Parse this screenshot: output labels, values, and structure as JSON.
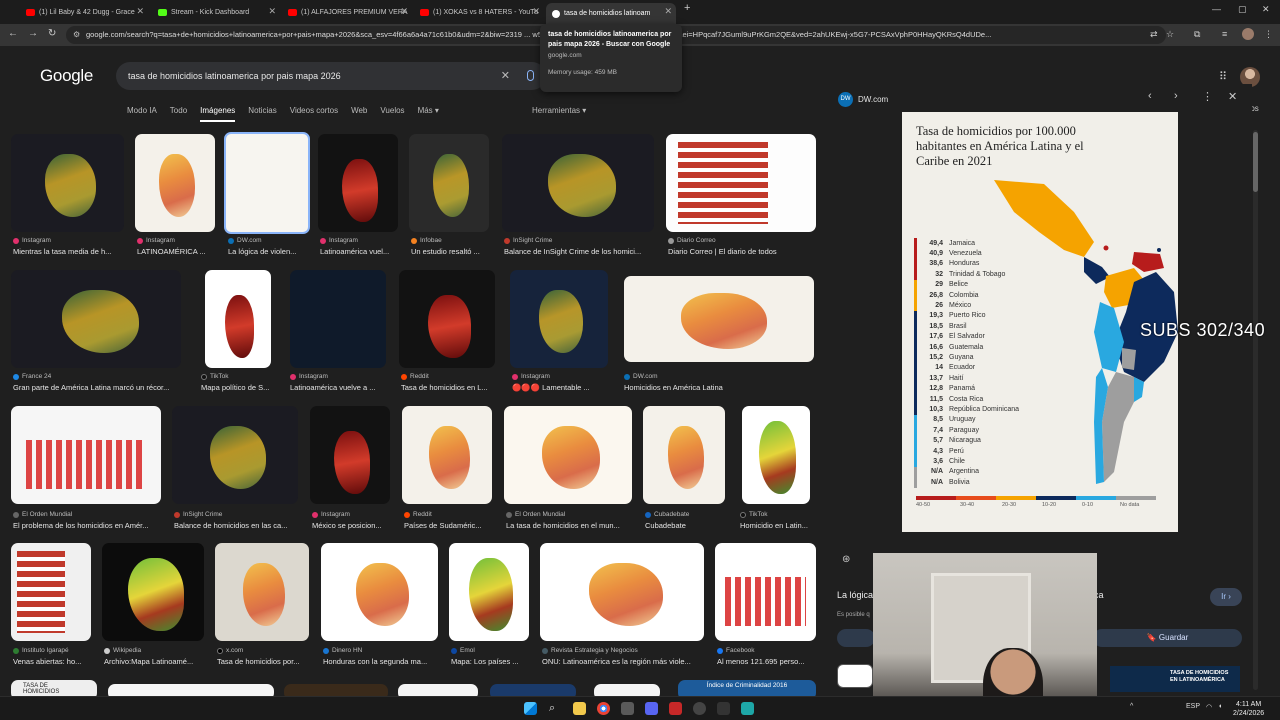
{
  "browser": {
    "tabs": [
      {
        "title": "(1) Lil Baby & 42 Dugg - Grace",
        "color": "#ff0000"
      },
      {
        "title": "Stream - Kick Dashboard",
        "color": "#53fc18"
      },
      {
        "title": "(1) ALFAJORES PREMIUM VERA",
        "color": "#ff0000"
      },
      {
        "title": "(1) XOKAS vs 8 HATERS - YouTu",
        "color": "#ff0000"
      },
      {
        "title": "tasa de homicidios latinoam",
        "color": "#ffffff"
      }
    ],
    "new_tab": "+",
    "url": "google.com/search?q=tasa+de+homicidios+latinoamerica+por+pais+mapa+2026&sca_esv=4f66a6a4a71c61b0&udm=2&biw=2319 ... w5EOAxUtV68XZM_A%3A1771895324440&ei=HPqcaf7JGuml9uPrKGm2QE&ved=2ahUKEwj-x5G7-PCSAxVphP0HHayQKRsQ4dUDe...",
    "tooltip": {
      "title": "tasa de homicidios latinoamerica por pais mapa 2026 - Buscar con Google",
      "domain": "google.com",
      "memory": "Memory usage: 459 MB"
    }
  },
  "google": {
    "logo": "Google",
    "query": "tasa de homicidios latinoamerica por pais mapa 2026",
    "tabs": [
      "Modo IA",
      "Todo",
      "Imágenes",
      "Noticias",
      "Videos cortos",
      "Web",
      "Vuelos",
      "Más ▾"
    ],
    "active_tab": "Imágenes",
    "tools": "Herramientas ▾",
    "saved": "Guardados"
  },
  "results": [
    {
      "src": "Instagram",
      "title": "Mientras la tasa media de h...",
      "color": "#e1306c"
    },
    {
      "src": "Instagram",
      "title": "LATINOAMÉRICA ...",
      "color": "#e1306c"
    },
    {
      "src": "DW.com",
      "title": "La lógica de violen...",
      "color": "#0b6fb5"
    },
    {
      "src": "Instagram",
      "title": "Latinoamérica vuel...",
      "color": "#e1306c"
    },
    {
      "src": "Infobae",
      "title": "Un estudio resaltó ...",
      "color": "#f58220"
    },
    {
      "src": "InSight Crime",
      "title": "Balance de InSight Crime de los homici...",
      "color": "#c0392b"
    },
    {
      "src": "Diario Correo",
      "title": "Diario Correo | El diario de todos",
      "color": "#999999"
    },
    {
      "src": "France 24",
      "title": "Gran parte de América Latina marcó un récor...",
      "color": "#1e88e5"
    },
    {
      "src": "TikTok",
      "title": "Mapa político de S...",
      "color": "#111111"
    },
    {
      "src": "Instagram",
      "title": "Latinoamérica vuelve a ...",
      "color": "#e1306c"
    },
    {
      "src": "Reddit",
      "title": "Tasa de homicidios en L...",
      "color": "#ff4500"
    },
    {
      "src": "Instagram",
      "title": "🔴🔴🔴 Lamentable ...",
      "color": "#e1306c"
    },
    {
      "src": "DW.com",
      "title": "Homicidios en América Latina",
      "color": "#0b6fb5"
    },
    {
      "src": "El Orden Mundial",
      "title": "El problema de los homicidios en Amér...",
      "color": "#666666"
    },
    {
      "src": "InSight Crime",
      "title": "Balance de homicidios en las ca...",
      "color": "#c0392b"
    },
    {
      "src": "Instagram",
      "title": "México se posicion...",
      "color": "#e1306c"
    },
    {
      "src": "Reddit",
      "title": "Países de Sudaméric...",
      "color": "#ff4500"
    },
    {
      "src": "El Orden Mundial",
      "title": "La tasa de homicidios en el mun...",
      "color": "#666666"
    },
    {
      "src": "Cubadebate",
      "title": "Cubadebate",
      "color": "#1565c0"
    },
    {
      "src": "TikTok",
      "title": "Homicidio en Latin...",
      "color": "#111111"
    },
    {
      "src": "Instituto Igarapé",
      "title": "Venas abiertas: ho...",
      "color": "#2e7d32"
    },
    {
      "src": "Wikipedia",
      "title": "Archivo:Mapa Latinoamé...",
      "color": "#cccccc"
    },
    {
      "src": "x.com",
      "title": "Tasa de homicidios por...",
      "color": "#000000"
    },
    {
      "src": "Dinero HN",
      "title": "Honduras con la segunda ma...",
      "color": "#1976d2"
    },
    {
      "src": "Emol",
      "title": "Mapa: Los países ...",
      "color": "#0d47a1"
    },
    {
      "src": "Revista Estrategia y Negocios",
      "title": "ONU: Latinoamérica es la región más viole...",
      "color": "#455a64"
    },
    {
      "src": "Facebook",
      "title": "Al menos 121.695 perso...",
      "color": "#1877f2"
    }
  ],
  "bottom_row_labels": [
    "TASA DE HOMICIDIOS",
    "Índice de Criminalidad 2016",
    "TASA DE HOMICIDIOS EN LATINOAMÉRICA"
  ],
  "panel": {
    "source": "DW.com",
    "source_badge": "DW",
    "controls": {
      "prev": "‹",
      "next": "›",
      "more": "⋮",
      "close": "✕"
    },
    "infographic": {
      "title": "Tasa de homicidios por 100.000 habitantes en América Latina y el Caribe en 2021",
      "rows": [
        {
          "v": "49,4",
          "c": "Jamaica",
          "col": "#b71c1c"
        },
        {
          "v": "40,9",
          "c": "Venezuela",
          "col": "#b71c1c"
        },
        {
          "v": "38,6",
          "c": "Honduras",
          "col": "#b71c1c"
        },
        {
          "v": "32",
          "c": "Trinidad & Tobago",
          "col": "#b71c1c"
        },
        {
          "v": "29",
          "c": "Belice",
          "col": "#f5a300"
        },
        {
          "v": "26,8",
          "c": "Colombia",
          "col": "#f5a300"
        },
        {
          "v": "26",
          "c": "México",
          "col": "#f5a300"
        },
        {
          "v": "19,3",
          "c": "Puerto Rico",
          "col": "#0d2a5c"
        },
        {
          "v": "18,5",
          "c": "Brasil",
          "col": "#0d2a5c"
        },
        {
          "v": "17,6",
          "c": "El Salvador",
          "col": "#0d2a5c"
        },
        {
          "v": "16,6",
          "c": "Guatemala",
          "col": "#0d2a5c"
        },
        {
          "v": "15,2",
          "c": "Guyana",
          "col": "#0d2a5c"
        },
        {
          "v": "14",
          "c": "Ecuador",
          "col": "#0d2a5c"
        },
        {
          "v": "13,7",
          "c": "Haití",
          "col": "#0d2a5c"
        },
        {
          "v": "12,8",
          "c": "Panamá",
          "col": "#0d2a5c"
        },
        {
          "v": "11,5",
          "c": "Costa Rica",
          "col": "#0d2a5c"
        },
        {
          "v": "10,3",
          "c": "República Dominicana",
          "col": "#0d2a5c"
        },
        {
          "v": "8,5",
          "c": "Uruguay",
          "col": "#29a8e0"
        },
        {
          "v": "7,4",
          "c": "Paraguay",
          "col": "#29a8e0"
        },
        {
          "v": "5,7",
          "c": "Nicaragua",
          "col": "#29a8e0"
        },
        {
          "v": "4,3",
          "c": "Perú",
          "col": "#29a8e0"
        },
        {
          "v": "3,6",
          "c": "Chile",
          "col": "#29a8e0"
        },
        {
          "v": "N/A",
          "c": "Argentina",
          "col": "#9e9e9e"
        },
        {
          "v": "N/A",
          "c": "Bolivia",
          "col": "#9e9e9e"
        }
      ],
      "legend": [
        "40-50",
        "30-40",
        "20-30",
        "10-20",
        "0-10",
        "No data"
      ],
      "legend_colors": [
        "#b71c1c",
        "#e74c1c",
        "#f5a300",
        "#0d2a5c",
        "#29a8e0",
        "#9e9e9e"
      ]
    },
    "bottom_title": "La lógica",
    "bottom_title_tail": "ca",
    "bottom_sub": "Es posible q",
    "ir_button": "Ir ›",
    "save_button": "Guardar"
  },
  "stream_overlay": "SUBS 302/340",
  "taskbar": {
    "lang": "ESP",
    "time": "4:11 AM",
    "date": "2/24/2026"
  }
}
